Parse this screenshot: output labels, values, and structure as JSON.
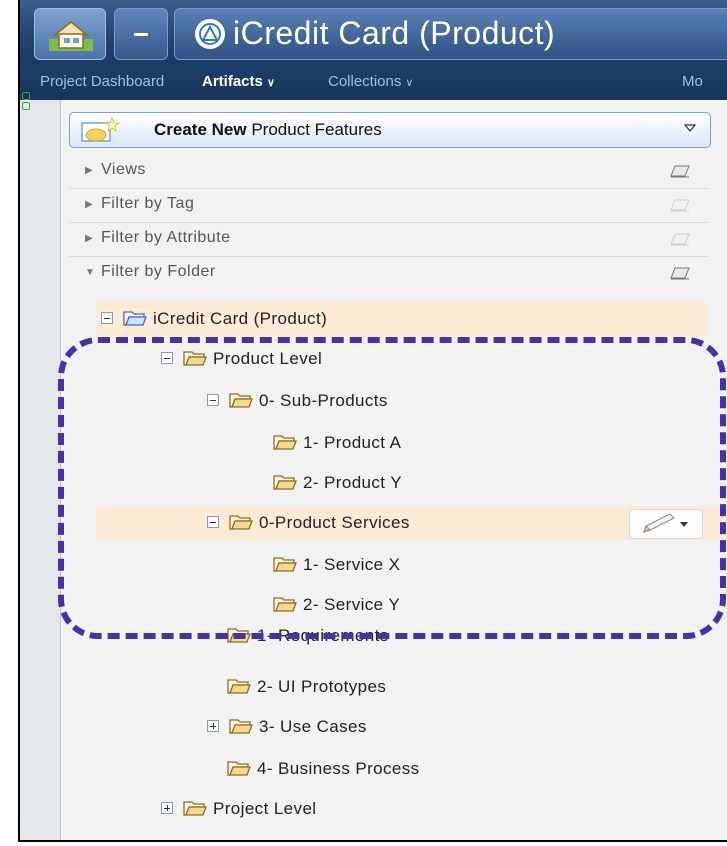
{
  "header": {
    "app_title": "iCredit Card (Product)",
    "home_icon": "house-icon",
    "logo_icon": "product-logo-icon"
  },
  "nav": {
    "items": [
      {
        "label": "Project Dashboard",
        "active": false,
        "dropdown": false
      },
      {
        "label": "Artifacts",
        "active": true,
        "dropdown": true
      },
      {
        "label": "Collections",
        "active": false,
        "dropdown": true
      },
      {
        "label": "Mo",
        "active": false,
        "dropdown": false
      }
    ]
  },
  "sidebar": {
    "create_button": {
      "bold": "Create New",
      "rest": " Product Features"
    },
    "filters": [
      {
        "label": "Views",
        "expanded": false
      },
      {
        "label": "Filter by Tag",
        "expanded": false
      },
      {
        "label": "Filter by Attribute",
        "expanded": false
      },
      {
        "label": "Filter by Folder",
        "expanded": true
      }
    ],
    "tree": [
      {
        "label": "iCredit Card (Product)",
        "toggle": "minus",
        "highlight": true,
        "root": true
      },
      {
        "label": "Product Level",
        "toggle": "minus"
      },
      {
        "label": "0- Sub-Products",
        "toggle": "minus"
      },
      {
        "label": "1- Product A",
        "toggle": "none"
      },
      {
        "label": "2- Product Y",
        "toggle": "none"
      },
      {
        "label": "0-Product Services",
        "toggle": "minus",
        "highlight": true,
        "edit": true
      },
      {
        "label": "1- Service X",
        "toggle": "none"
      },
      {
        "label": "2- Service Y",
        "toggle": "none"
      },
      {
        "label": "1- Requirements",
        "toggle": "none"
      },
      {
        "label": "2- UI Prototypes",
        "toggle": "none"
      },
      {
        "label": "3- Use Cases",
        "toggle": "plus"
      },
      {
        "label": "4- Business Process",
        "toggle": "none"
      },
      {
        "label": "Project Level",
        "toggle": "plus"
      }
    ]
  },
  "colors": {
    "accent_dash": "#4b2fa5",
    "highlight_row": "#fdebd5",
    "title_bar": "#24436f"
  }
}
